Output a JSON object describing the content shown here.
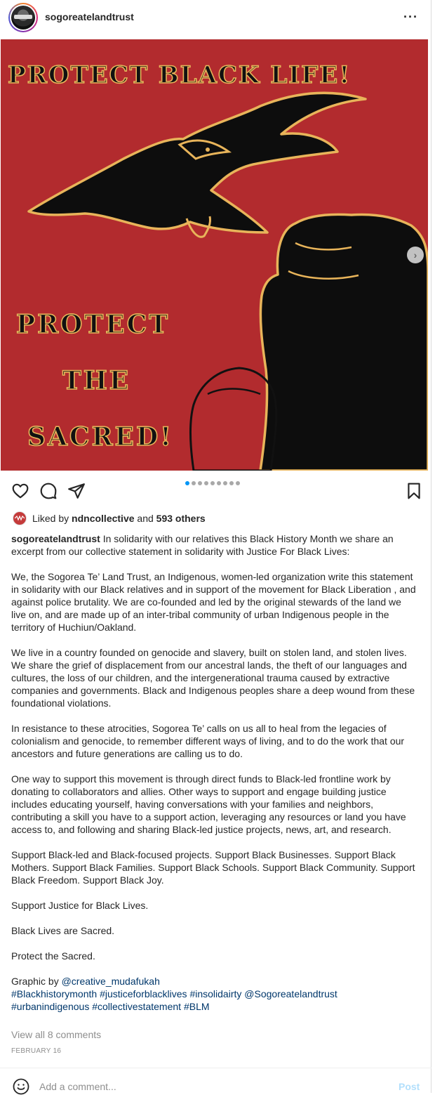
{
  "header": {
    "username": "sogoreatelandtrust",
    "more_label": "···"
  },
  "image": {
    "headline": "PROTECT BLACK LIFE!",
    "line1": "PROTECT",
    "line2": "THE",
    "line3": "SACRED!",
    "background_color": "#b22b2e",
    "outline_color": "#e8b45a",
    "carousel_slides": 9,
    "carousel_active": 1
  },
  "likes": {
    "prefix": "Liked by",
    "user": "ndncollective",
    "middle": "and",
    "others": "593 others"
  },
  "caption": {
    "username": "sogoreatelandtrust",
    "intro": "In solidarity with our relatives this Black History Month we share an excerpt from our collective statement in solidarity with Justice For Black Lives:",
    "p1": "We, the Sogorea Te’ Land Trust, an Indigenous, women-led organization write this statement in solidarity with our Black relatives and in support of the movement for Black Liberation , and against police brutality. We are co-founded and led by the original stewards of the land we live on, and are made up of an inter-tribal community of urban Indigenous people in the territory of Huchiun/Oakland.",
    "p2": "We live in a country founded on genocide and slavery, built on stolen land, and stolen lives. We share the grief of displacement from our ancestral lands, the theft of our languages and cultures, the loss of our children, and the intergenerational trauma caused by extractive companies and governments. Black and Indigenous peoples share a deep wound from these foundational violations.",
    "p3": "In resistance to these atrocities, Sogorea Te’ calls on us all to heal from the legacies of colonialism and genocide, to remember different ways of living, and to do the work that our ancestors and future generations are calling us to do.",
    "p4": "One way to support this movement is through direct funds to Black-led frontline work by donating to collaborators and allies. Other ways to support and engage building justice includes educating yourself, having conversations with your families and neighbors, contributing a skill you have to a support action, leveraging any resources or land you have access to, and following and sharing Black-led justice projects, news, art, and research.",
    "p5": "Support Black-led and Black-focused projects. Support Black Businesses. Support Black Mothers. Support Black Families. Support Black Schools. Support Black Community. Support Black Freedom. Support Black Joy.",
    "p6": "Support Justice for Black Lives.",
    "p7": "Black Lives are Sacred.",
    "p8": "Protect the Sacred.",
    "graphic_prefix": "Graphic by",
    "graphic_credit": "@creative_mudafukah",
    "tag1": "#Blackhistorymonth",
    "tag2": "#justiceforblacklives",
    "tag3": "#insolidairty",
    "tag4": "@Sogoreatelandtrust",
    "tag5": "#urbanindigenous",
    "tag6": "#collectivestatement",
    "tag7": "#BLM"
  },
  "view_comments": "View all 8 comments",
  "date": "FEBRUARY 16",
  "comment_box": {
    "placeholder": "Add a comment...",
    "post_label": "Post"
  },
  "icons": {
    "like": "heart-icon",
    "comment": "comment-icon",
    "share": "paper-plane-icon",
    "save": "bookmark-icon",
    "emoji": "smiley-icon",
    "next": "chevron-right-icon"
  }
}
